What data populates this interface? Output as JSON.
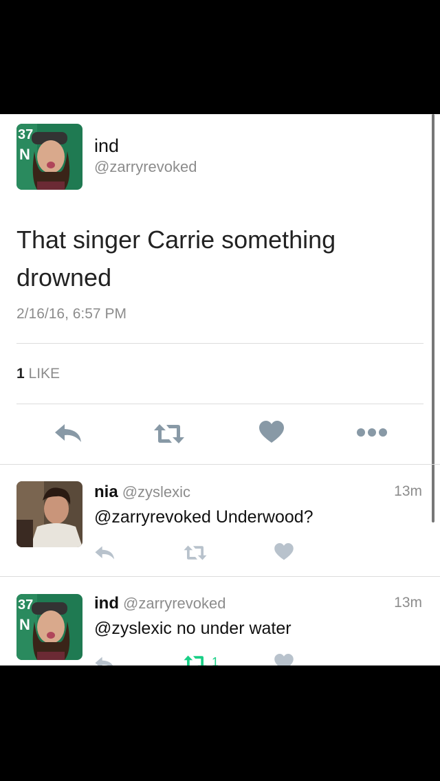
{
  "tweet": {
    "author_name": "ind",
    "author_handle": "@zarryrevoked",
    "text": "That singer Carrie something drowned",
    "timestamp": "2/16/16, 6:57 PM",
    "likes_count": "1",
    "likes_label": "LIKE",
    "actions": [
      "reply-icon",
      "retweet-icon",
      "heart-icon",
      "more-icon"
    ]
  },
  "replies": [
    {
      "name": "nia",
      "handle": "@zyslexic",
      "time": "13m",
      "text": "@zarryrevoked Underwood?"
    },
    {
      "name": "ind",
      "handle": "@zarryrevoked",
      "time": "13m",
      "text": "@zyslexic no under water",
      "retweet_count": "1"
    }
  ],
  "colors": {
    "icon_gray": "#8899a6",
    "icon_light": "#b8c2cc",
    "retweet_green": "#19cf86",
    "avatar_green": "#1f7a52"
  }
}
